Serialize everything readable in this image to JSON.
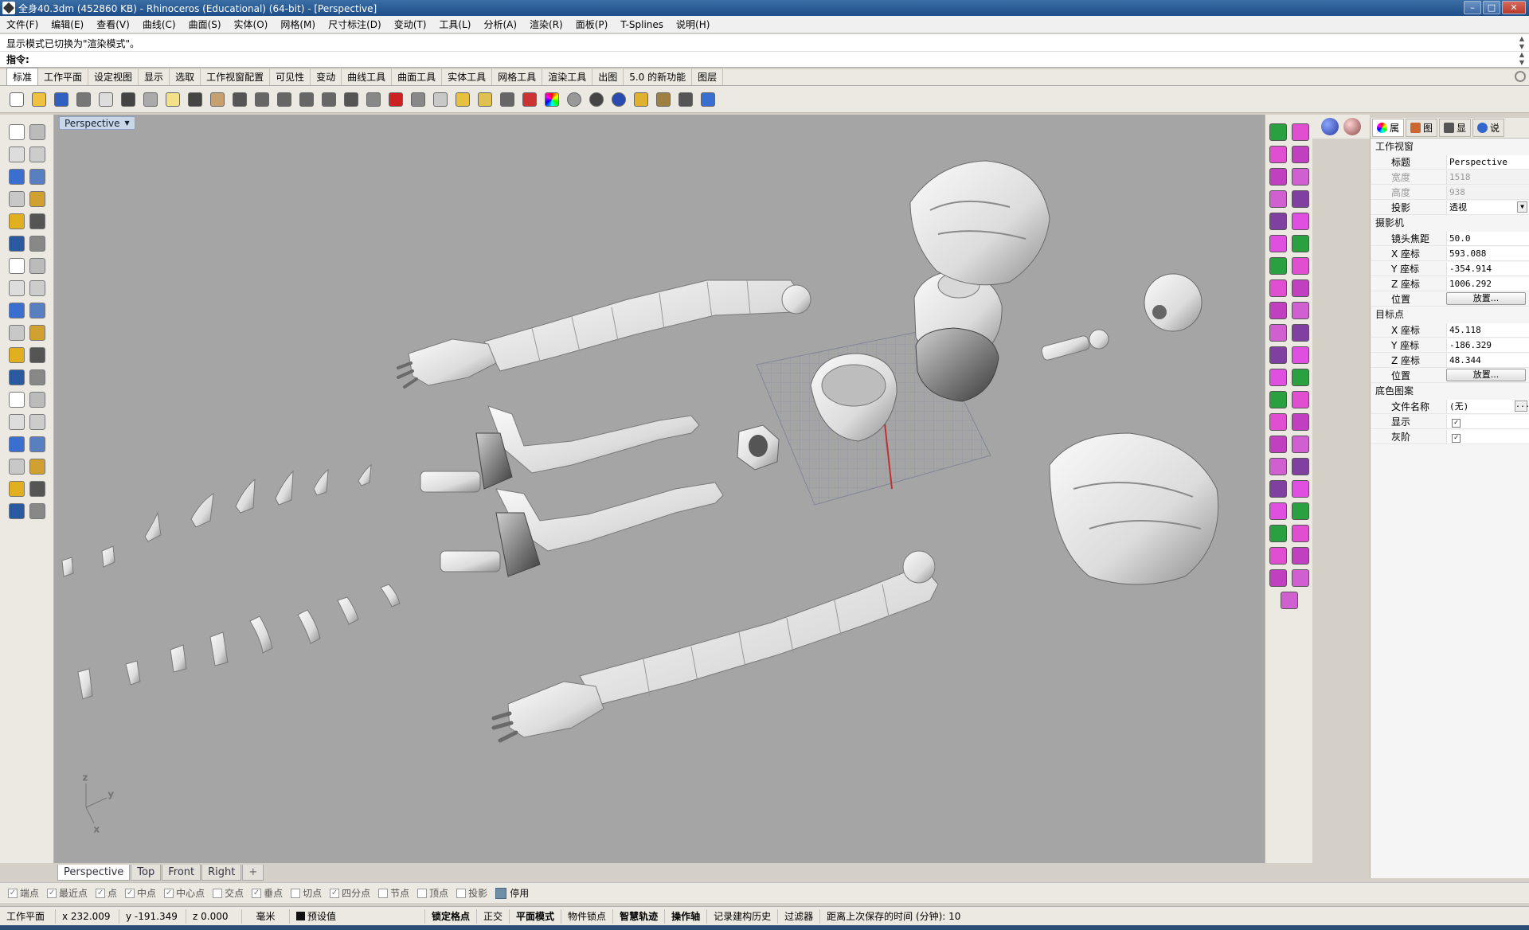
{
  "window": {
    "title": "全身40.3dm (452860 KB) - Rhinoceros (Educational) (64-bit) - [Perspective]",
    "buttons": {
      "minimize": "–",
      "maximize": "□",
      "close": "✕"
    }
  },
  "menu": [
    "文件(F)",
    "编辑(E)",
    "查看(V)",
    "曲线(C)",
    "曲面(S)",
    "实体(O)",
    "网格(M)",
    "尺寸标注(D)",
    "变动(T)",
    "工具(L)",
    "分析(A)",
    "渲染(R)",
    "面板(P)",
    "T-Splines",
    "说明(H)"
  ],
  "command": {
    "history": "显示模式已切换为\"渲染模式\"。",
    "prompt_label": "指令:",
    "value": ""
  },
  "toolbar_tabs": [
    "标准",
    "工作平面",
    "设定视图",
    "显示",
    "选取",
    "工作视窗配置",
    "可见性",
    "变动",
    "曲线工具",
    "曲面工具",
    "实体工具",
    "网格工具",
    "渲染工具",
    "出图",
    "5.0 的新功能",
    "图层"
  ],
  "toolbar_icons": [
    "new-file",
    "open-file",
    "save",
    "print",
    "import",
    "cut",
    "copy",
    "paste",
    "undo",
    "pan",
    "move",
    "zoom-in",
    "zoom-window",
    "zoom-extents",
    "zoom-selected",
    "rotate-view",
    "four-viewports",
    "car-shade",
    "point",
    "circle",
    "render-light",
    "lightbulb",
    "lock",
    "material",
    "color-wheel",
    "sphere-shade",
    "sphere-dark",
    "render-sphere",
    "flashlight",
    "gear-settings",
    "dimension",
    "help"
  ],
  "viewport": {
    "label": "Perspective",
    "axis_labels": {
      "z": "z",
      "y": "y",
      "x": "x"
    },
    "tabs": [
      "Perspective",
      "Top",
      "Front",
      "Right",
      "+"
    ]
  },
  "properties": {
    "tabs": [
      "属",
      "图",
      "显",
      "说"
    ],
    "section_viewport": "工作视窗",
    "title_label": "标题",
    "title_value": "Perspective",
    "width_label": "宽度",
    "width_value": "1518",
    "height_label": "高度",
    "height_value": "938",
    "projection_label": "投影",
    "projection_value": "透视",
    "section_camera": "摄影机",
    "lens_label": "镜头焦距",
    "lens_value": "50.0",
    "cam_x_label": "X 座标",
    "cam_x_value": "593.088",
    "cam_y_label": "Y 座标",
    "cam_y_value": "-354.914",
    "cam_z_label": "Z 座标",
    "cam_z_value": "1006.292",
    "cam_pos_label": "位置",
    "place_button": "放置...",
    "section_target": "目标点",
    "tgt_x_label": "X 座标",
    "tgt_x_value": "45.118",
    "tgt_y_label": "Y 座标",
    "tgt_y_value": "-186.329",
    "tgt_z_label": "Z 座标",
    "tgt_z_value": "48.344",
    "tgt_pos_label": "位置",
    "section_background": "底色图案",
    "filename_label": "文件名称",
    "filename_value": "(无)",
    "browse_button": "...",
    "show_label": "显示",
    "gray_label": "灰阶"
  },
  "osnap": {
    "items": [
      {
        "label": "端点",
        "checked": true
      },
      {
        "label": "最近点",
        "checked": true
      },
      {
        "label": "点",
        "checked": true
      },
      {
        "label": "中点",
        "checked": true
      },
      {
        "label": "中心点",
        "checked": true
      },
      {
        "label": "交点",
        "checked": false
      },
      {
        "label": "垂点",
        "checked": true
      },
      {
        "label": "切点",
        "checked": false
      },
      {
        "label": "四分点",
        "checked": true
      },
      {
        "label": "节点",
        "checked": false
      },
      {
        "label": "顶点",
        "checked": false
      },
      {
        "label": "投影",
        "checked": false
      }
    ],
    "disable_label": "停用"
  },
  "status": {
    "cplane": "工作平面",
    "x": "x 232.009",
    "y": "y -191.349",
    "z": "z 0.000",
    "units": "毫米",
    "layer": "预设值",
    "grid_snap": "锁定格点",
    "ortho": "正交",
    "planar": "平面模式",
    "osnap": "物件锁点",
    "smarttrack": "智慧轨迹",
    "gumball": "操作轴",
    "history": "记录建构历史",
    "filter": "过滤器",
    "save_time": "距离上次保存的时间 (分钟): 10"
  },
  "colors": {
    "titlebar": "#1f4e88",
    "viewport_bg": "#a5a5a5",
    "grid": "#8a8f9e",
    "model": "#e8e8e8",
    "x_axis": "#c03030",
    "y_axis": "#30a040"
  }
}
